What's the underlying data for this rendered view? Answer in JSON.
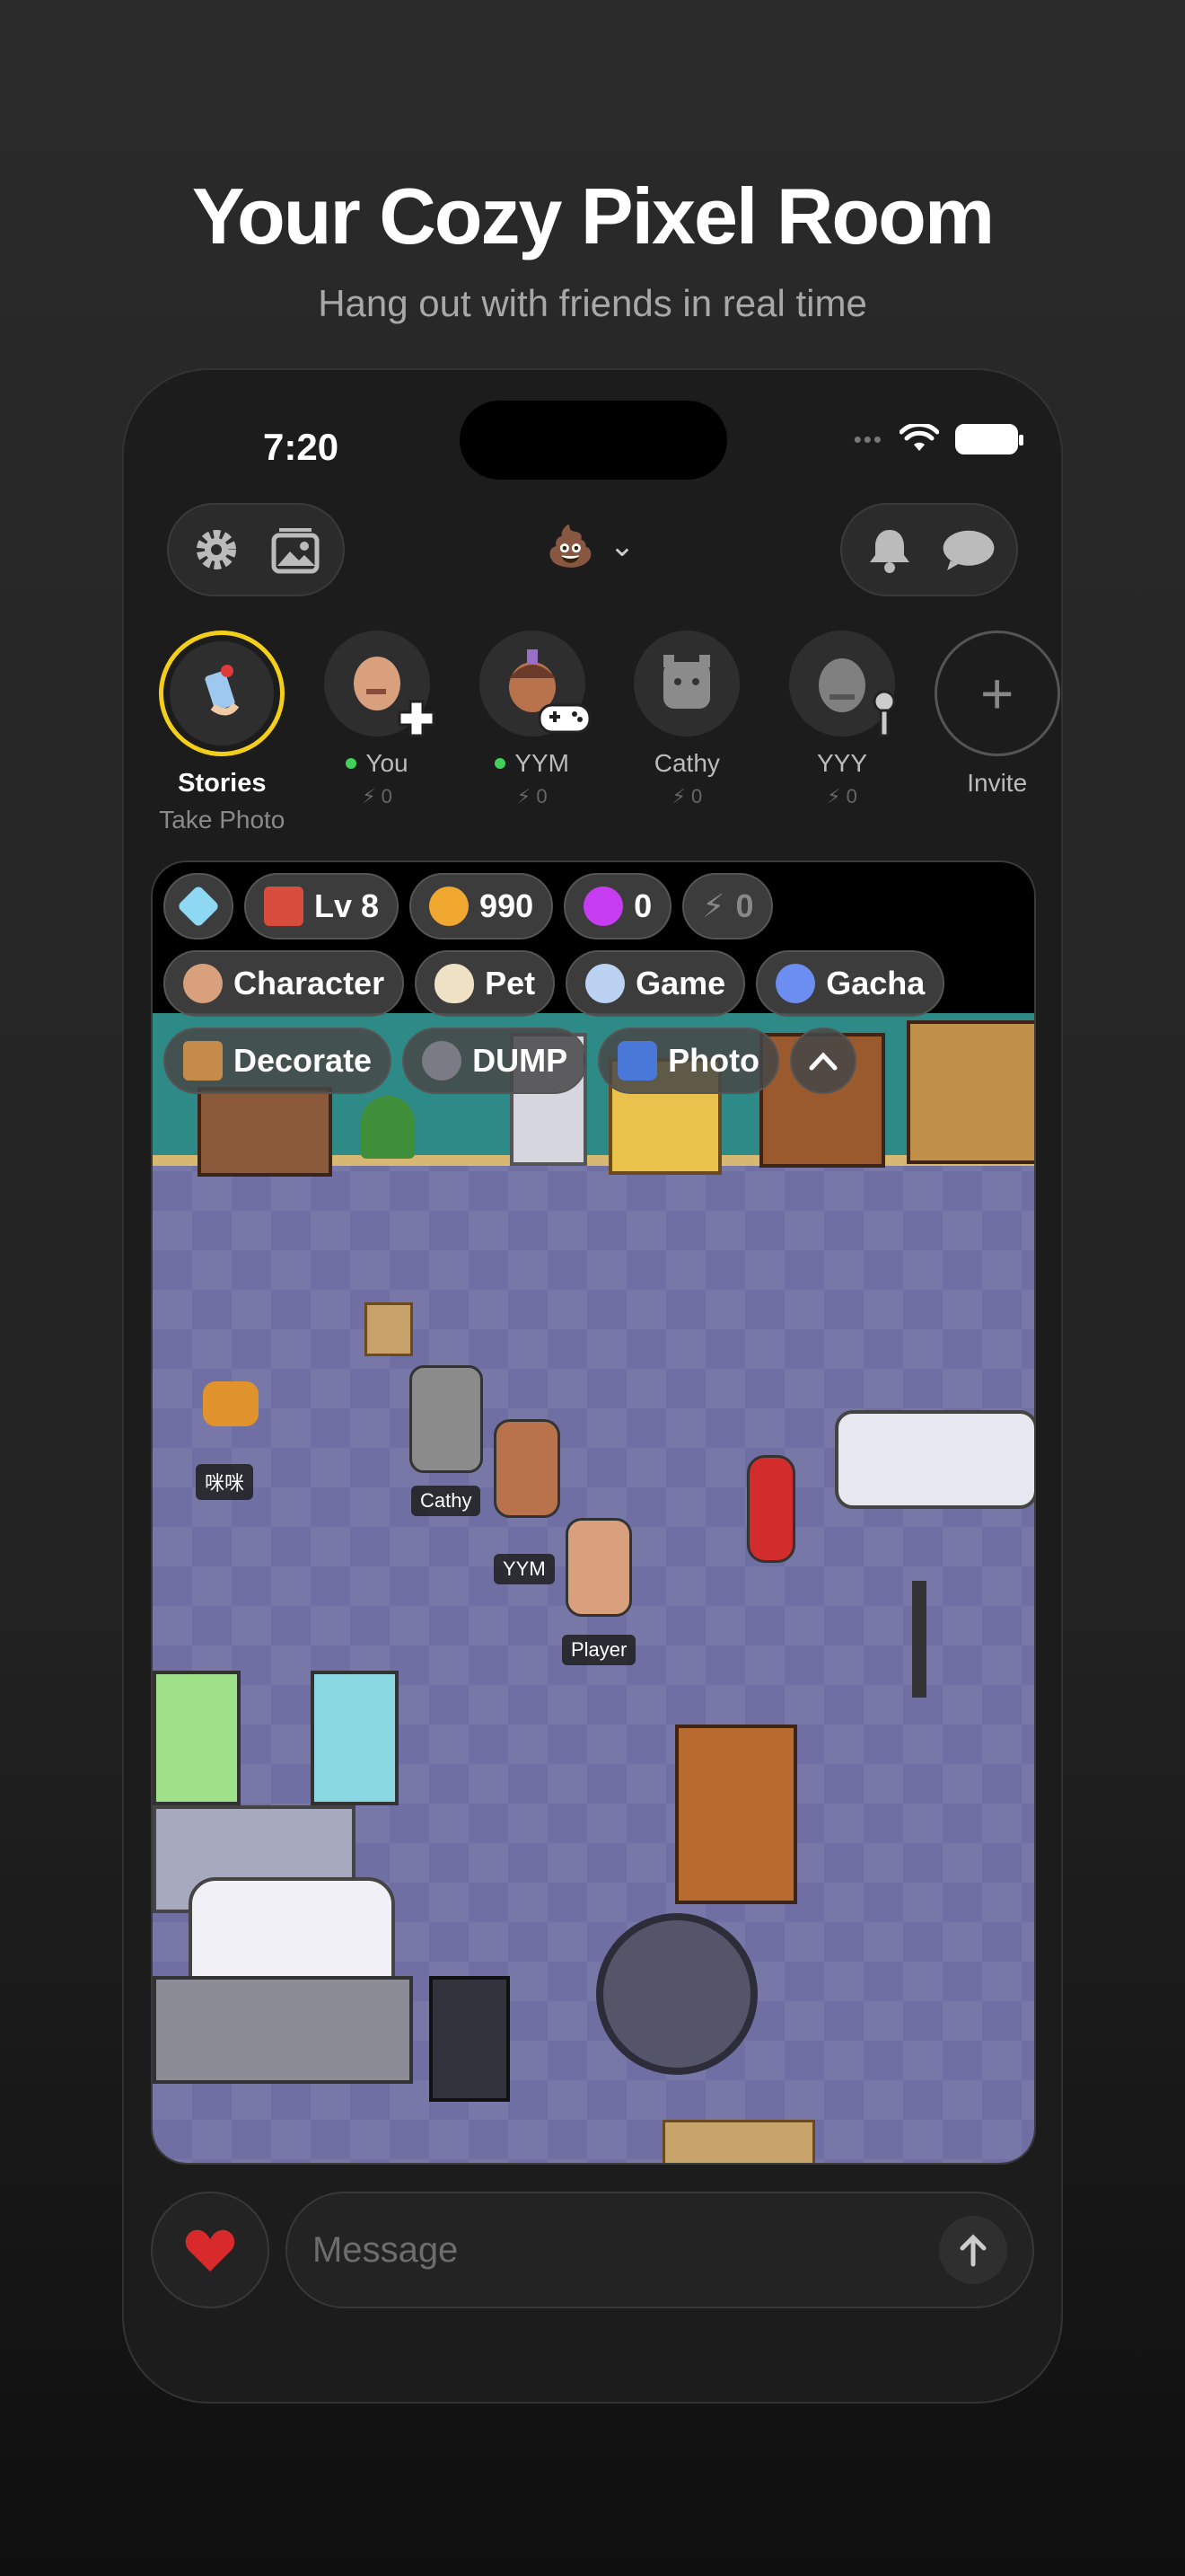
{
  "hero": {
    "title": "Your Cozy Pixel Room",
    "subtitle": "Hang out with friends in real time"
  },
  "status_bar": {
    "time": "7:20",
    "dots": "•••"
  },
  "top_bar": {
    "left_icons": [
      "gear-icon",
      "gallery-icon"
    ],
    "room_emoji": "💩",
    "right_icons": [
      "bell-icon",
      "chat-bubble-icon"
    ]
  },
  "stories": [
    {
      "name": "Stories",
      "sub": "Take Photo"
    },
    {
      "name": "You",
      "online": true,
      "energy": "0"
    },
    {
      "name": "YYM",
      "online": true,
      "energy": "0"
    },
    {
      "name": "Cathy",
      "online": false,
      "energy": "0"
    },
    {
      "name": "YYY",
      "online": false,
      "energy": "0"
    },
    {
      "name": "Invite",
      "icon": "+"
    }
  ],
  "hud": {
    "level": "Lv 8",
    "coins": "990",
    "points": "0",
    "energy": "0",
    "menu": [
      "Character",
      "Pet",
      "Game",
      "Gacha"
    ],
    "menu2": [
      "Decorate",
      "DUMP",
      "Photo"
    ]
  },
  "room": {
    "labels": {
      "pet": "咪咪",
      "cathy": "Cathy",
      "yym": "YYM",
      "player": "Player"
    }
  },
  "composer": {
    "placeholder": "Message"
  },
  "colors": {
    "accent_ring": "#f4cf1a",
    "online": "#3fd15a",
    "floor": "#6f6fa3",
    "wall": "#2e8a86"
  }
}
